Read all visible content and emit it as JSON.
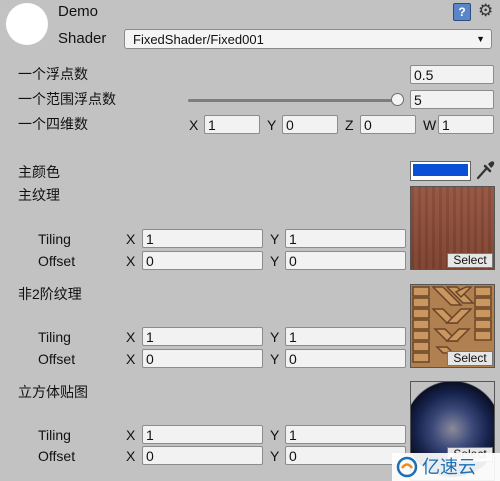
{
  "header": {
    "name": "Demo",
    "shader_label": "Shader",
    "shader_value": "FixedShader/Fixed001"
  },
  "icons": {
    "help": "help-book-icon",
    "settings": "gear-icon",
    "dropdown": "chevron-down-icon",
    "picker": "eyedropper-icon",
    "help_glyph": "?",
    "gear_glyph": "⚙",
    "dropdown_glyph": "▼"
  },
  "properties": {
    "float": {
      "label": "一个浮点数",
      "value": "0.5"
    },
    "range": {
      "label": "一个范围浮点数",
      "value": "5",
      "slider_fraction": 1.0
    },
    "vector": {
      "label": "一个四维数",
      "x_label": "X",
      "x": "1",
      "y_label": "Y",
      "y": "0",
      "z_label": "Z",
      "z": "0",
      "w_label": "W",
      "w": "1"
    },
    "color": {
      "label": "主颜色",
      "value": "#0a4fd6"
    }
  },
  "textures": [
    {
      "label": "主纹理",
      "tiling_label": "Tiling",
      "offset_label": "Offset",
      "tiling_x": "1",
      "tiling_y": "1",
      "offset_x": "0",
      "offset_y": "0",
      "select_label": "Select"
    },
    {
      "label": "非2阶纹理",
      "tiling_label": "Tiling",
      "offset_label": "Offset",
      "tiling_x": "1",
      "tiling_y": "1",
      "offset_x": "0",
      "offset_y": "0",
      "select_label": "Select"
    },
    {
      "label": "立方体贴图",
      "tiling_label": "Tiling",
      "offset_label": "Offset",
      "tiling_x": "1",
      "tiling_y": "1",
      "offset_x": "0",
      "offset_y": "0",
      "select_label": "Select"
    }
  ],
  "axis": {
    "x": "X",
    "y": "Y"
  },
  "watermark": {
    "text": "亿速云"
  }
}
